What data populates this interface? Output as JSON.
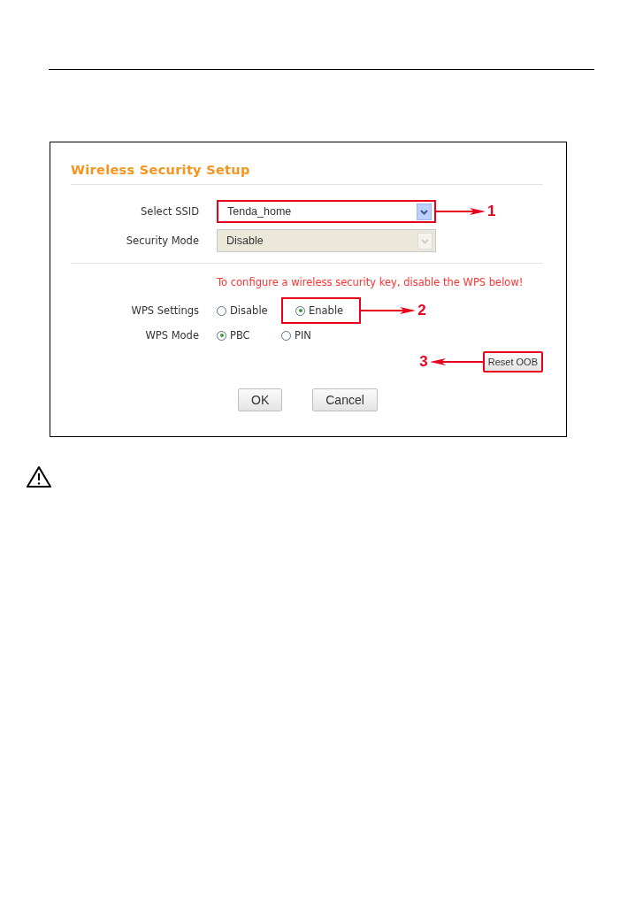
{
  "form": {
    "title": "Wireless Security Setup",
    "fields": [
      {
        "label": "Select SSID",
        "value": "Tenda_home",
        "disabled": false,
        "highlighted": true,
        "callout": "1"
      },
      {
        "label": "Security Mode",
        "value": "Disable",
        "disabled": true,
        "highlighted": false
      }
    ],
    "notice": "To configure a wireless security key, disable the WPS below!",
    "radio_groups": [
      {
        "label": "WPS Settings",
        "options": [
          {
            "label": "Disable",
            "selected": false,
            "highlighted": false
          },
          {
            "label": "Enable",
            "selected": true,
            "highlighted": true,
            "callout": "2"
          }
        ]
      },
      {
        "label": "WPS Mode",
        "options": [
          {
            "label": "PBC",
            "selected": true,
            "highlighted": false
          },
          {
            "label": "PIN",
            "selected": false,
            "highlighted": false
          }
        ]
      }
    ],
    "reset_button": {
      "label": "Reset OOB",
      "highlighted": true,
      "callout": "3"
    },
    "buttons": [
      "OK",
      "Cancel"
    ]
  }
}
